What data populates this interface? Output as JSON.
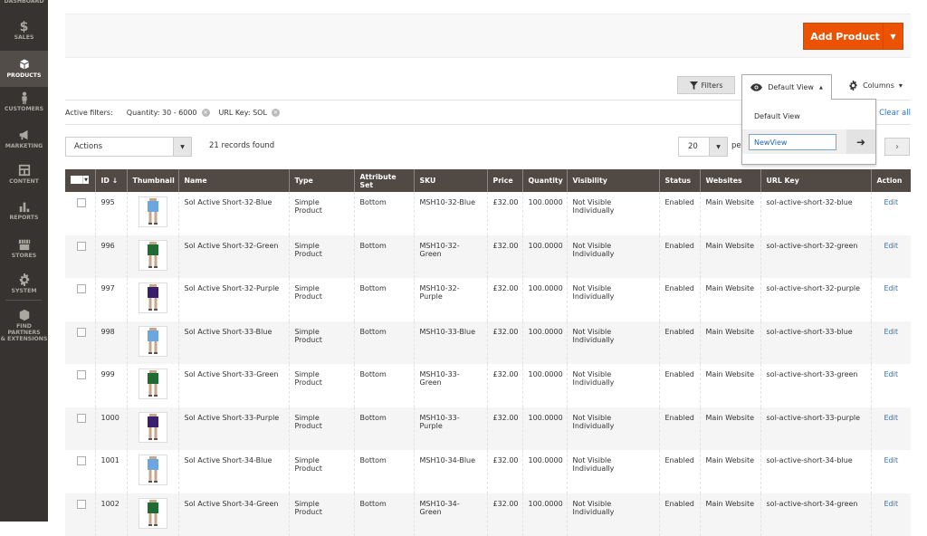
{
  "sidebar": {
    "items": [
      {
        "label": "DASHBOARD",
        "icon": "dashboard-icon"
      },
      {
        "label": "SALES",
        "icon": "dollar-icon"
      },
      {
        "label": "PRODUCTS",
        "icon": "cube-icon",
        "active": true
      },
      {
        "label": "CUSTOMERS",
        "icon": "person-icon"
      },
      {
        "label": "MARKETING",
        "icon": "megaphone-icon"
      },
      {
        "label": "CONTENT",
        "icon": "layout-icon"
      },
      {
        "label": "REPORTS",
        "icon": "bar-chart-icon"
      },
      {
        "label": "STORES",
        "icon": "storefront-icon"
      },
      {
        "label": "SYSTEM",
        "icon": "gear-icon"
      },
      {
        "label": "FIND PARTNERS",
        "label2": "& EXTENSIONS",
        "icon": "partners-cube-icon"
      }
    ]
  },
  "page_actions": {
    "add_product": "Add Product",
    "split_arrow": "▼",
    "accent": "#eb5202"
  },
  "toolbar": {
    "filters": "Filters",
    "view": "Default View",
    "view_arrow": "▲",
    "columns": "Columns",
    "columns_arrow": "▾"
  },
  "views_dropdown": {
    "option": "Default View",
    "new_view_value": "NewView",
    "go_icon": "➜"
  },
  "active_filters": {
    "label": "Active filters:",
    "chips": [
      "Quantity: 30 - 6000",
      "URL Key: SOL"
    ],
    "clear_all": "Clear all"
  },
  "grid_controls": {
    "actions": "Actions",
    "records_found": "21 records found",
    "per_page": "20",
    "per_page_label": "per page",
    "next": "›"
  },
  "table": {
    "columns": [
      "",
      "ID ↓",
      "Thumbnail",
      "Name",
      "Type",
      "Attribute Set",
      "SKU",
      "Price",
      "Quantity",
      "Visibility",
      "Status",
      "Websites",
      "URL Key",
      "Action"
    ],
    "rows": [
      {
        "id": "995",
        "color": "#6aa7e0",
        "name": "Sol Active Short-32-Blue",
        "type": "Simple Product",
        "attr_set": "Bottom",
        "sku": "MSH10-32-Blue",
        "price": "£32.00",
        "qty": "100.0000",
        "visibility": "Not Visible Individually",
        "status": "Enabled",
        "websites": "Main Website",
        "url_key": "sol-active-short-32-blue",
        "action": "Edit"
      },
      {
        "id": "996",
        "color": "#1f6b34",
        "name": "Sol Active Short-32-Green",
        "type": "Simple Product",
        "attr_set": "Bottom",
        "sku": "MSH10-32-Green",
        "price": "£32.00",
        "qty": "100.0000",
        "visibility": "Not Visible Individually",
        "status": "Enabled",
        "websites": "Main Website",
        "url_key": "sol-active-short-32-green",
        "action": "Edit"
      },
      {
        "id": "997",
        "color": "#3a1f6e",
        "name": "Sol Active Short-32-Purple",
        "type": "Simple Product",
        "attr_set": "Bottom",
        "sku": "MSH10-32-Purple",
        "price": "£32.00",
        "qty": "100.0000",
        "visibility": "Not Visible Individually",
        "status": "Enabled",
        "websites": "Main Website",
        "url_key": "sol-active-short-32-purple",
        "action": "Edit"
      },
      {
        "id": "998",
        "color": "#6aa7e0",
        "name": "Sol Active Short-33-Blue",
        "type": "Simple Product",
        "attr_set": "Bottom",
        "sku": "MSH10-33-Blue",
        "price": "£32.00",
        "qty": "100.0000",
        "visibility": "Not Visible Individually",
        "status": "Enabled",
        "websites": "Main Website",
        "url_key": "sol-active-short-33-blue",
        "action": "Edit"
      },
      {
        "id": "999",
        "color": "#1f6b34",
        "name": "Sol Active Short-33-Green",
        "type": "Simple Product",
        "attr_set": "Bottom",
        "sku": "MSH10-33-Green",
        "price": "£32.00",
        "qty": "100.0000",
        "visibility": "Not Visible Individually",
        "status": "Enabled",
        "websites": "Main Website",
        "url_key": "sol-active-short-33-green",
        "action": "Edit"
      },
      {
        "id": "1000",
        "color": "#3a1f6e",
        "name": "Sol Active Short-33-Purple",
        "type": "Simple Product",
        "attr_set": "Bottom",
        "sku": "MSH10-33-Purple",
        "price": "£32.00",
        "qty": "100.0000",
        "visibility": "Not Visible Individually",
        "status": "Enabled",
        "websites": "Main Website",
        "url_key": "sol-active-short-33-purple",
        "action": "Edit"
      },
      {
        "id": "1001",
        "color": "#6aa7e0",
        "name": "Sol Active Short-34-Blue",
        "type": "Simple Product",
        "attr_set": "Bottom",
        "sku": "MSH10-34-Blue",
        "price": "£32.00",
        "qty": "100.0000",
        "visibility": "Not Visible Individually",
        "status": "Enabled",
        "websites": "Main Website",
        "url_key": "sol-active-short-34-blue",
        "action": "Edit"
      },
      {
        "id": "1002",
        "color": "#1f6b34",
        "name": "Sol Active Short-34-Green",
        "type": "Simple Product",
        "attr_set": "Bottom",
        "sku": "MSH10-34-Green",
        "price": "£32.00",
        "qty": "100.0000",
        "visibility": "Not Visible Individually",
        "status": "Enabled",
        "websites": "Main Website",
        "url_key": "sol-active-short-34-green",
        "action": "Edit"
      }
    ]
  }
}
